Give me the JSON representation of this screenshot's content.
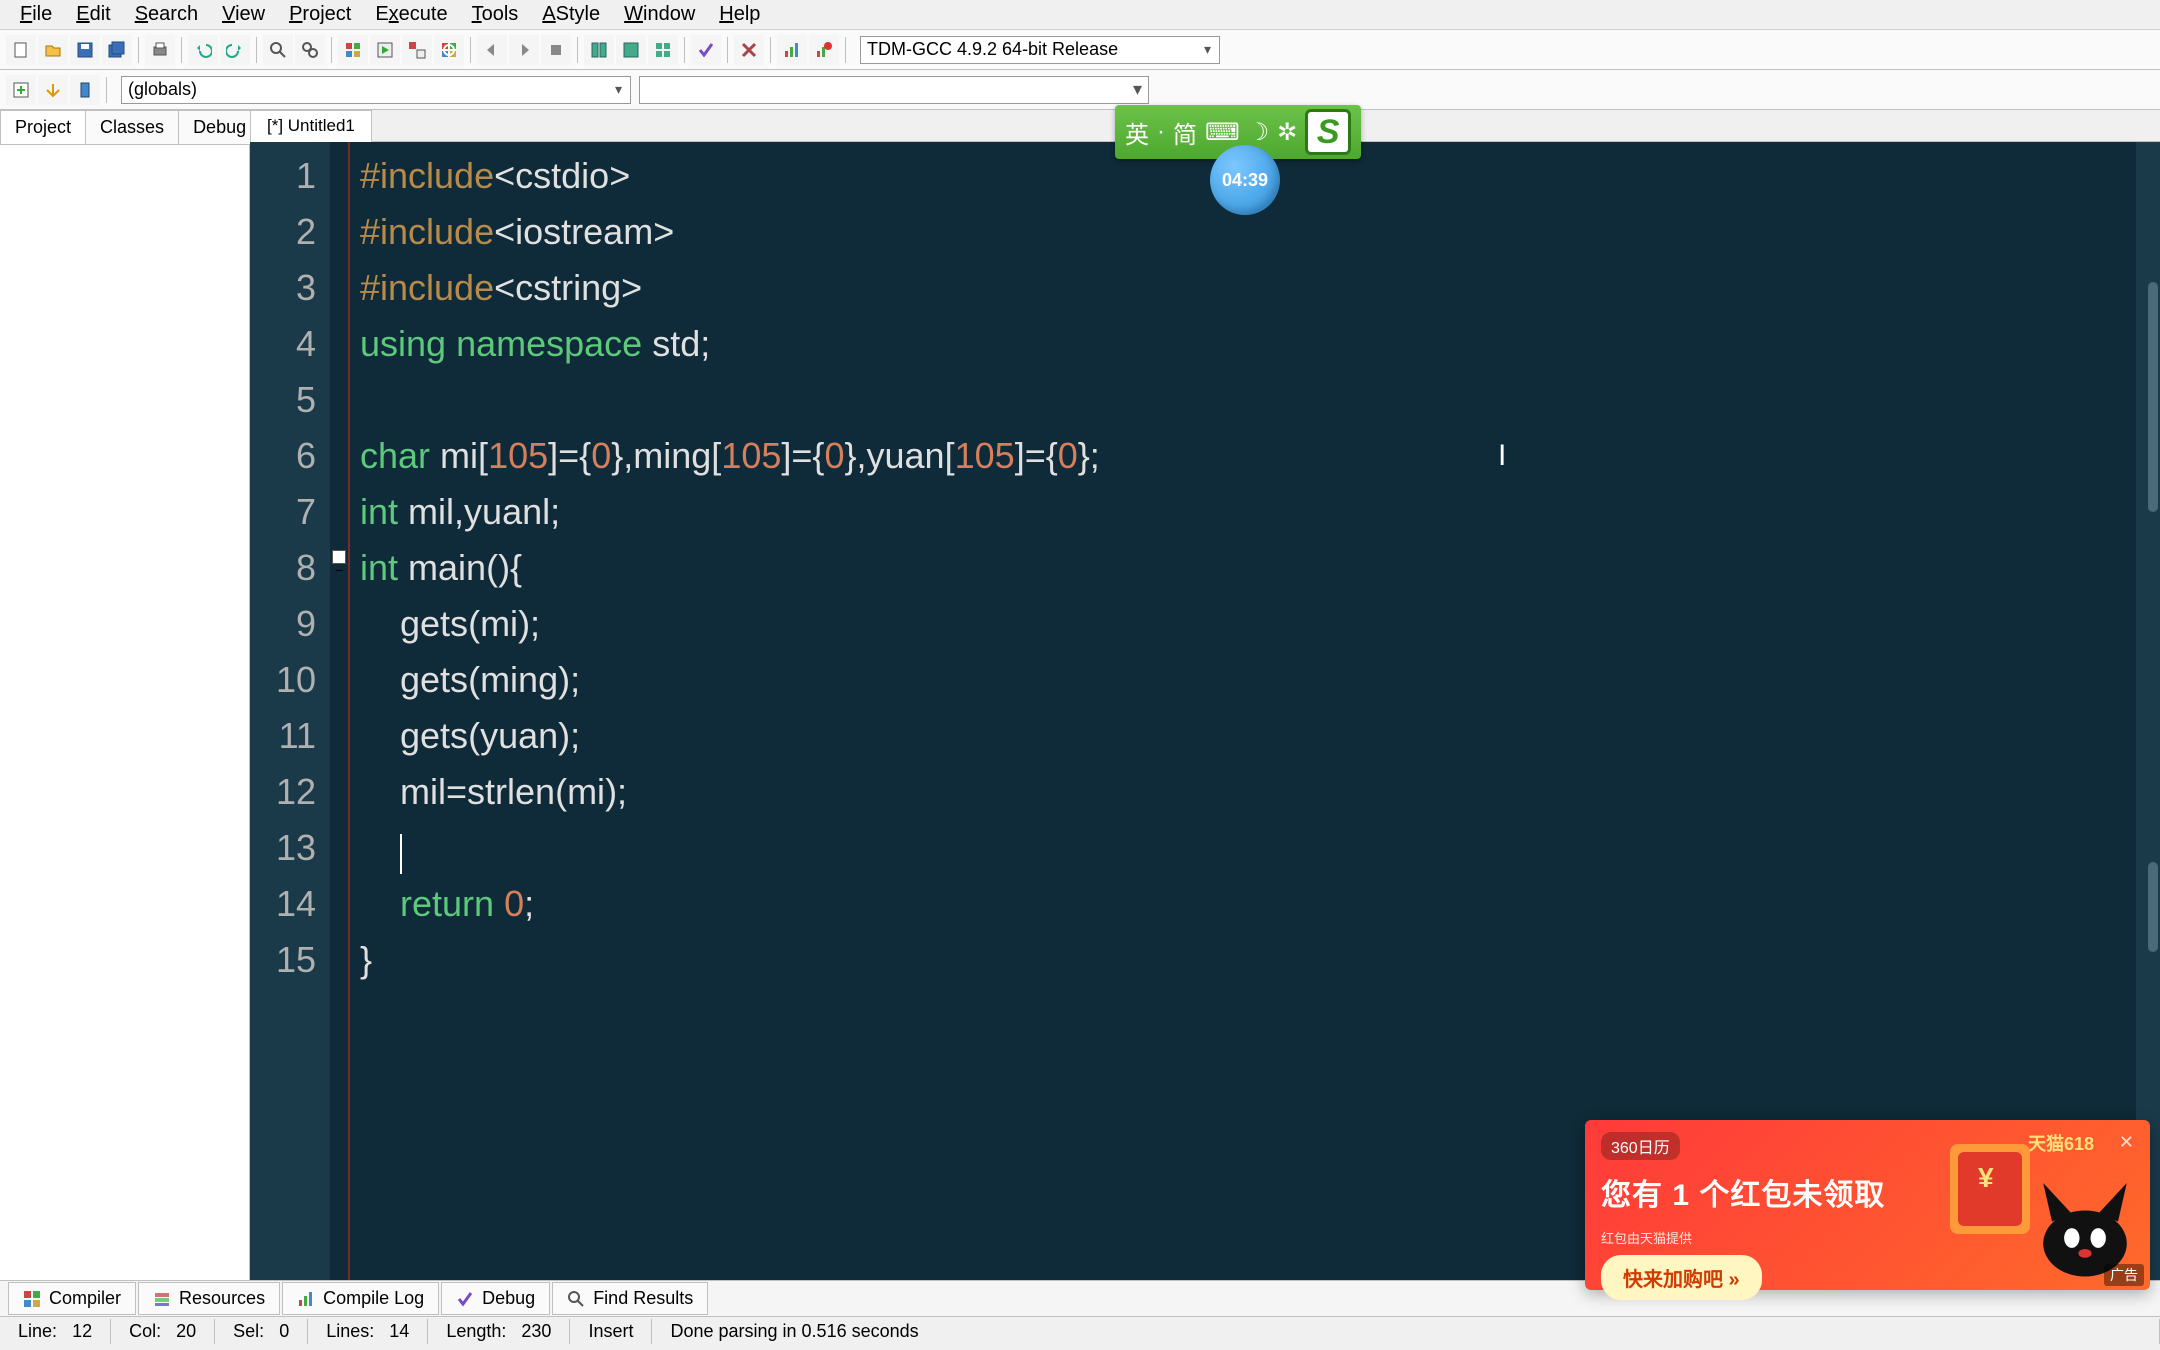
{
  "menu": {
    "file": "File",
    "edit": "Edit",
    "search": "Search",
    "view": "View",
    "project": "Project",
    "execute": "Execute",
    "tools": "Tools",
    "astyle": "AStyle",
    "window": "Window",
    "help": "Help"
  },
  "toolbar": {
    "compiler_selected": "TDM-GCC 4.9.2 64-bit Release"
  },
  "toolbar2": {
    "scope": "(globals)"
  },
  "side_tabs": {
    "project": "Project",
    "classes": "Classes",
    "debug": "Debug"
  },
  "file_tab": "[*] Untitled1",
  "code_lines": [
    "#include<cstdio>",
    "#include<iostream>",
    "#include<cstring>",
    "using namespace std;",
    "",
    "char mi[105]={0},ming[105]={0},yuan[105]={0};",
    "int mil,yuanl;",
    "int main(){",
    "    gets(mi);",
    "    gets(ming);",
    "    gets(yuan);",
    "    mil=strlen(mi);",
    "    ",
    "    return 0;",
    "}"
  ],
  "line_count": 15,
  "ime": {
    "lang": "英",
    "mode": "简",
    "badge": "S"
  },
  "time_badge": "04:39",
  "ad": {
    "brand1": "360日历",
    "brand2": "天猫618",
    "headline": "您有 1 个红包未领取",
    "button": "快来加购吧 »",
    "subtext": "红包由天猫提供",
    "corner": "广告"
  },
  "bottom_tabs": {
    "compiler": "Compiler",
    "resources": "Resources",
    "compile_log": "Compile Log",
    "debug": "Debug",
    "find_results": "Find Results"
  },
  "status": {
    "line_label": "Line:",
    "line": "12",
    "col_label": "Col:",
    "col": "20",
    "sel_label": "Sel:",
    "sel": "0",
    "lines_label": "Lines:",
    "lines": "14",
    "length_label": "Length:",
    "length": "230",
    "mode": "Insert",
    "parse": "Done parsing in 0.516 seconds"
  }
}
